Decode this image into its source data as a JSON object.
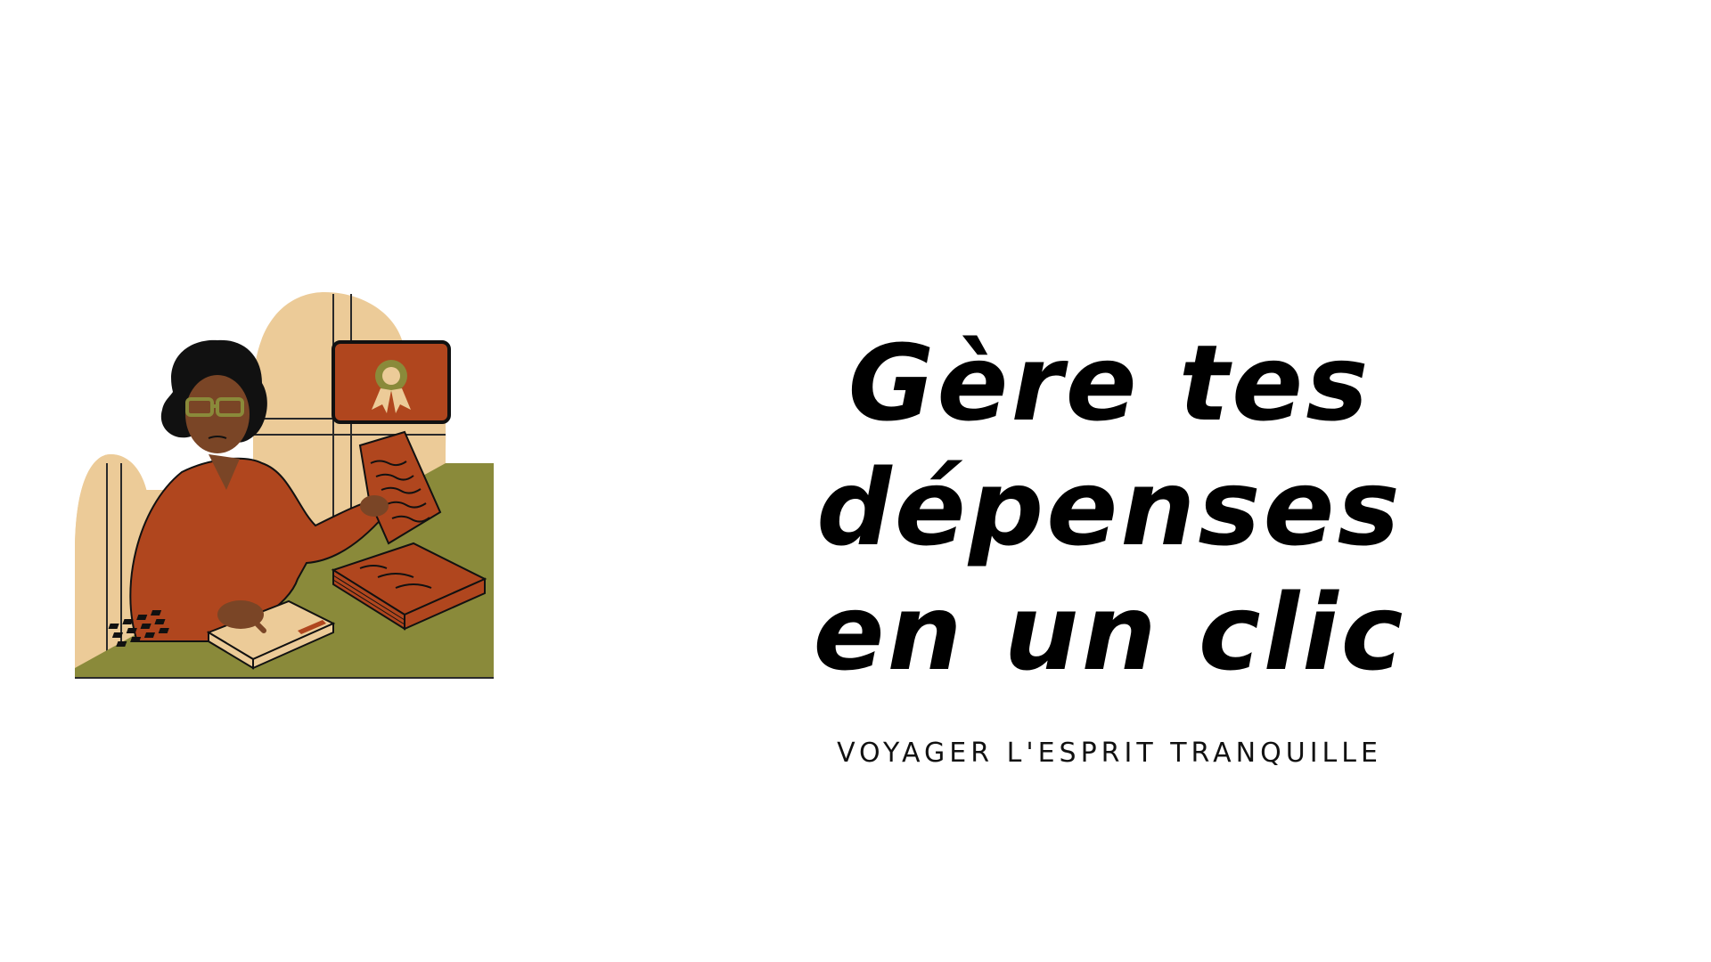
{
  "colors": {
    "background": "#ffffff",
    "text": "#000000",
    "illustration_beige": "#eccb98",
    "illustration_olive": "#8a8a3a",
    "illustration_rust": "#b0461e",
    "illustration_skin": "#7a4526"
  },
  "headline": {
    "line1": "Gère tes dépenses",
    "line2": "en un clic"
  },
  "tagline": "VOYAGER L'ESPRIT TRANQUILLE",
  "illustration": {
    "icons": [
      "woman-with-calculator",
      "certificate-frame-icon",
      "document-stack",
      "calculator-icon"
    ]
  }
}
